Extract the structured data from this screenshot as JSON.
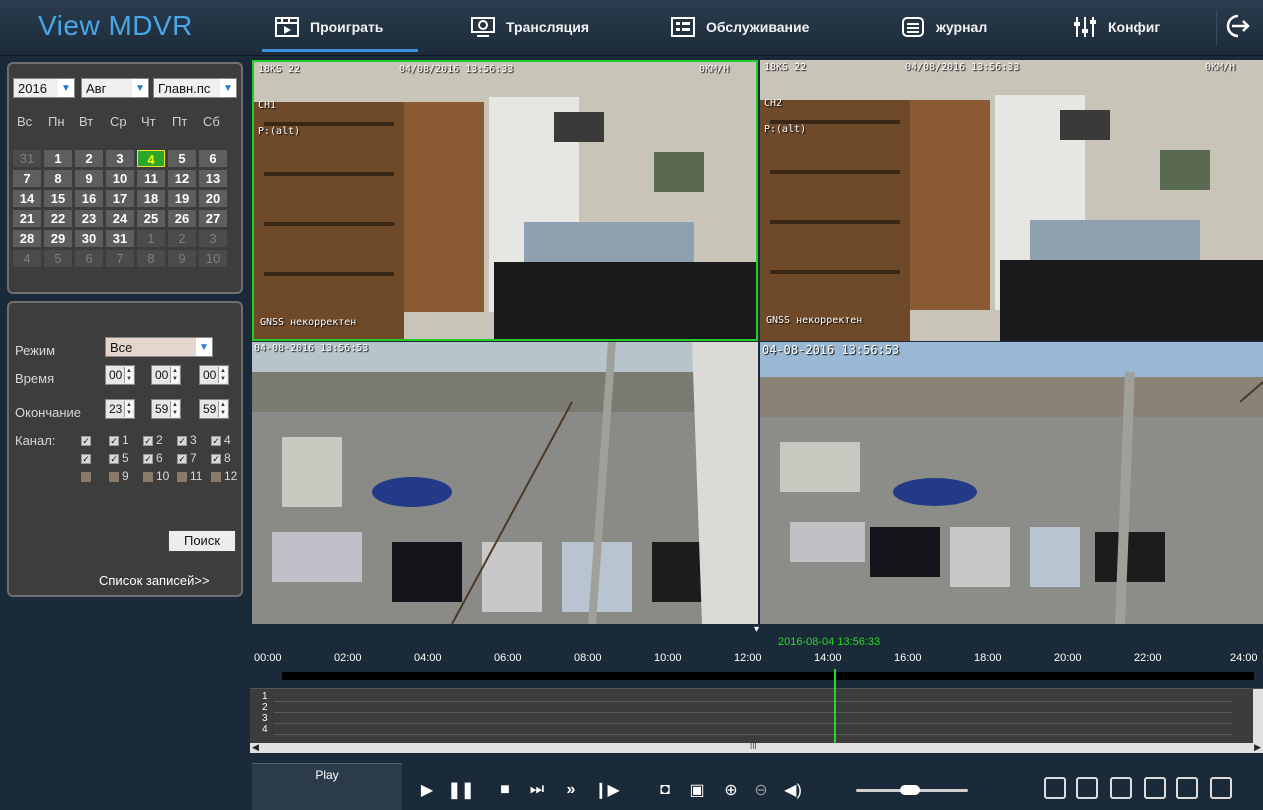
{
  "app": {
    "title": "View MDVR"
  },
  "nav": {
    "tabs": [
      {
        "label": "Проиграть",
        "icon": "playback-icon"
      },
      {
        "label": "Трансляция",
        "icon": "live-icon"
      },
      {
        "label": "Обслуживание",
        "icon": "maintenance-icon"
      },
      {
        "label": "журнал",
        "icon": "log-icon"
      },
      {
        "label": "Конфиг",
        "icon": "config-icon"
      }
    ],
    "active_tab": "Проиграть",
    "exit_icon": "exit-icon"
  },
  "calendar": {
    "year": "2016",
    "month": "Авг",
    "stream": "Главн.пс",
    "weekdays": [
      "Вс",
      "Пн",
      "Вт",
      "Ср",
      "Чт",
      "Пт",
      "Сб"
    ],
    "weeks": [
      [
        "31",
        "1",
        "2",
        "3",
        "4",
        "5",
        "6"
      ],
      [
        "7",
        "8",
        "9",
        "10",
        "11",
        "12",
        "13"
      ],
      [
        "14",
        "15",
        "16",
        "17",
        "18",
        "19",
        "20"
      ],
      [
        "21",
        "22",
        "23",
        "24",
        "25",
        "26",
        "27"
      ],
      [
        "28",
        "29",
        "30",
        "31",
        "1",
        "2",
        "3"
      ],
      [
        "4",
        "5",
        "6",
        "7",
        "8",
        "9",
        "10"
      ]
    ],
    "selected_day": "4"
  },
  "filter": {
    "mode_label": "Режим",
    "mode_value": "Все",
    "start_label": "Время",
    "start": [
      "00",
      "00",
      "00"
    ],
    "end_label": "Окончание",
    "end": [
      "23",
      "59",
      "59"
    ],
    "channel_label": "Канал:",
    "channels": [
      {
        "n": "1",
        "checked": true
      },
      {
        "n": "2",
        "checked": true
      },
      {
        "n": "3",
        "checked": true
      },
      {
        "n": "4",
        "checked": true
      },
      {
        "n": "5",
        "checked": true
      },
      {
        "n": "6",
        "checked": true
      },
      {
        "n": "7",
        "checked": true
      },
      {
        "n": "8",
        "checked": true
      },
      {
        "n": "9",
        "checked": false
      },
      {
        "n": "10",
        "checked": false
      },
      {
        "n": "11",
        "checked": false
      },
      {
        "n": "12",
        "checked": false
      }
    ],
    "search_label": "Поиск",
    "record_list_label": "Список записей>>"
  },
  "cameras": [
    {
      "top_left": "18KS 22",
      "datetime": "04/08/2016 13:56:33",
      "speed": "0KM/H",
      "ch": "CH1",
      "pin": "P:(alt)",
      "gnss": "GNSS некорректен"
    },
    {
      "top_left": "18KS 22",
      "datetime": "04/08/2016 13:56:33",
      "speed": "0KM/H",
      "ch": "CH2",
      "pin": "P:(alt)",
      "gnss": "GNSS некорректен"
    },
    {
      "top_left": "04-08-2016 13:56:53"
    },
    {
      "top_left": "04-08-2016 13:56:53"
    }
  ],
  "timeline": {
    "ticks": [
      "00:00",
      "02:00",
      "04:00",
      "06:00",
      "08:00",
      "10:00",
      "12:00",
      "14:00",
      "16:00",
      "18:00",
      "20:00",
      "22:00",
      "24:00"
    ],
    "current": "2016-08-04 13:56:33",
    "channels": [
      "1",
      "2",
      "3",
      "4"
    ]
  },
  "controls": {
    "play_label": "Play",
    "scroll_mid": "III"
  }
}
